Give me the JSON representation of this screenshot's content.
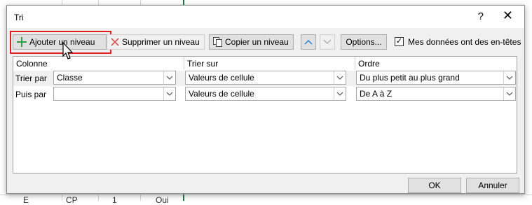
{
  "background_sheet": {
    "bottom_row": [
      "E",
      "CP",
      "1",
      "Oui"
    ]
  },
  "dialog": {
    "title": "Tri",
    "help_glyph": "?",
    "close_glyph": "✕"
  },
  "toolbar": {
    "add_level": "Ajouter un niveau",
    "delete_level": "Supprimer un niveau",
    "copy_level": "Copier un niveau",
    "options": "Options...",
    "headers_checkbox_label": "Mes données ont des en-têtes",
    "headers_checked": true,
    "checkmark": "✓"
  },
  "grid": {
    "headers": [
      "Colonne",
      "Trier sur",
      "Ordre"
    ],
    "rows": [
      {
        "label": "Trier par",
        "column": "Classe",
        "sort_on": "Valeurs de cellule",
        "order": "Du plus petit au plus grand"
      },
      {
        "label": "Puis par",
        "column": "",
        "sort_on": "Valeurs de cellule",
        "order": "De A à Z"
      }
    ]
  },
  "footer": {
    "ok": "OK",
    "cancel": "Annuler"
  },
  "colors": {
    "highlight": "#e01e1e",
    "add_icon": "#2e9e3e",
    "delete_icon": "#d9534f",
    "arrow_active": "#2a7fd4"
  }
}
